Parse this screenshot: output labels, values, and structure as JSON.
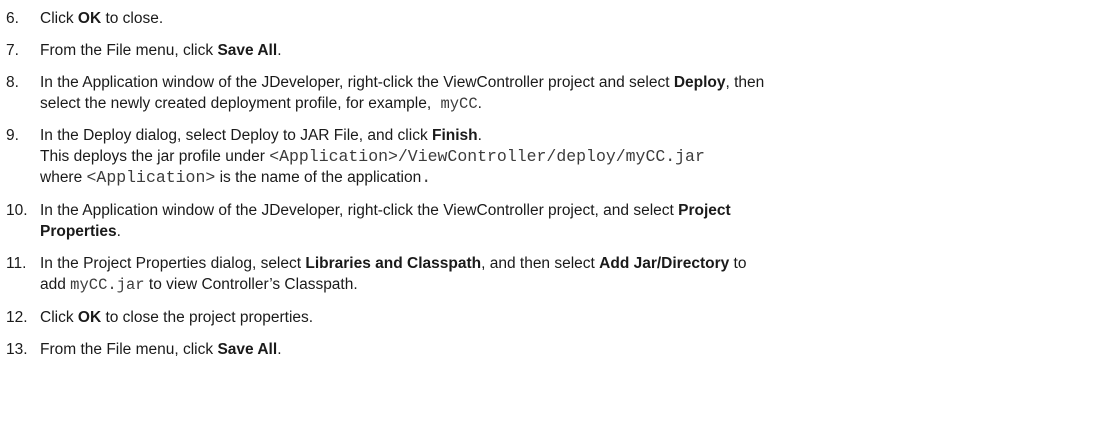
{
  "steps": [
    {
      "num": "6.",
      "lines": [
        [
          {
            "t": "Click "
          },
          {
            "t": "OK",
            "b": true
          },
          {
            "t": " to close."
          }
        ]
      ]
    },
    {
      "num": "7.",
      "lines": [
        [
          {
            "t": "From the File menu, click "
          },
          {
            "t": "Save All",
            "b": true
          },
          {
            "t": "."
          }
        ]
      ]
    },
    {
      "num": "8.",
      "lines": [
        [
          {
            "t": "In the Application window of the JDeveloper, right-click the ViewController project and select "
          },
          {
            "t": "Deploy",
            "b": true
          },
          {
            "t": ", then"
          }
        ],
        [
          {
            "t": "select the newly created deployment profile, for example,"
          },
          {
            "t": " myCC",
            "m": true
          },
          {
            "t": "."
          }
        ]
      ]
    },
    {
      "num": "9.",
      "lines": [
        [
          {
            "t": "In the Deploy dialog, select Deploy to JAR File, and click "
          },
          {
            "t": "Finish",
            "b": true
          },
          {
            "t": "."
          }
        ],
        [
          {
            "t": "This deploys the jar profile under "
          },
          {
            "t": " <Application>/ViewController/deploy/myCC.jar",
            "m": true,
            "lg": true
          }
        ],
        [
          {
            "t": "where "
          },
          {
            "t": "<Application>",
            "m": true,
            "lg": true
          },
          {
            "t": " is the name of the application"
          },
          {
            "t": ".",
            "m": true,
            "lg": true
          }
        ]
      ]
    },
    {
      "num": "10.",
      "lines": [
        [
          {
            "t": "In the Application window of the JDeveloper, right-click the ViewController project, and select "
          },
          {
            "t": "Project",
            "b": true
          }
        ],
        [
          {
            "t": "Properties",
            "b": true
          },
          {
            "t": "."
          }
        ]
      ]
    },
    {
      "num": "11.",
      "lines": [
        [
          {
            "t": " In the Project Properties dialog, select "
          },
          {
            "t": "Libraries and Classpath",
            "b": true
          },
          {
            "t": ", and then select "
          },
          {
            "t": "Add Jar/Directory",
            "b": true
          },
          {
            "t": " to"
          }
        ],
        [
          {
            "t": "add "
          },
          {
            "t": "myCC.jar",
            "m": true
          },
          {
            "t": " to view Controller’s Classpath."
          }
        ]
      ]
    },
    {
      "num": "12.",
      "lines": [
        [
          {
            "t": "Click "
          },
          {
            "t": "OK",
            "b": true
          },
          {
            "t": " to close the project properties."
          }
        ]
      ]
    },
    {
      "num": "13.",
      "lines": [
        [
          {
            "t": "From the File menu, click "
          },
          {
            "t": "Save All",
            "b": true
          },
          {
            "t": "."
          }
        ]
      ]
    }
  ]
}
